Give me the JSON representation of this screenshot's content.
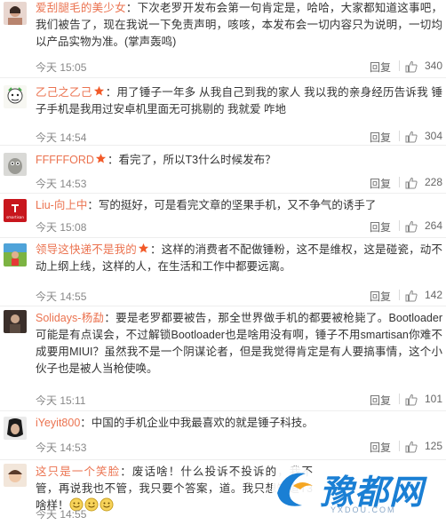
{
  "comments": [
    {
      "user": "爱刮腿毛的美少女",
      "verified": false,
      "text": "下次老罗开发布会第一句肯定是，哈哈，大家都知道这事吧，我们被告了，现在我说一下免责声明，咳咳，本发布会一切内容只为说明，一切均以产品实物为准。(掌声轰鸣)",
      "time": "今天 15:05",
      "reply": "回复",
      "likes": "340"
    },
    {
      "user": "乙己之乙己",
      "verified": true,
      "text": "用了锤子一年多 从我自己到我的家人 我以我的亲身经历告诉我  锤子手机是我用过安卓机里面无可挑剔的  我就爱 咋地",
      "time": "今天 14:54",
      "reply": "回复",
      "likes": "304"
    },
    {
      "user": "FFFFFORD",
      "verified": true,
      "text": "看完了，所以T3什么时候发布？",
      "time": "今天 14:53",
      "reply": "回复",
      "likes": "228"
    },
    {
      "user": "Liu-向上中",
      "verified": false,
      "text": "写的挺好，可是看完文章的坚果手机，又不争气的诱手了",
      "time": "今天 15:08",
      "reply": "回复",
      "likes": "264",
      "avatar_caption": "smartisan"
    },
    {
      "user": "领导这快递不是我的",
      "verified": true,
      "text": "这样的消费者不配做锤粉，这不是维权，这是碰瓷，动不动上纲上线，这样的人，在生活和工作中都要远离。",
      "time": "今天 14:55",
      "reply": "回复",
      "likes": "142"
    },
    {
      "user": "Solidays-杨勐",
      "verified": false,
      "text": "要是老罗都要被告，那全世界做手机的都要被枪毙了。Bootloader可能是有点误会，不过解锁Bootloader也是啥用没有啊，锤子不用smartisan你难不成要用MIUI？虽然我不是一个阴谋论者，但是我觉得肯定是有人要搞事情，这个小伙子也是被人当枪使唤。",
      "time": "今天 15:11",
      "reply": "回复",
      "likes": "101"
    },
    {
      "user": "iYeyit800",
      "verified": false,
      "text": "中国的手机企业中我最喜欢的就是锤子科技。",
      "time": "今天 14:53",
      "reply": "回复",
      "likes": "125"
    },
    {
      "user": "这只是一个笑脸",
      "verified": false,
      "text": "废话啥！什么投诉不投诉的，我不管，再说我也不管，我只要个答案，道。我只想知道T3啥样！",
      "time": "今天 14:55",
      "reply": "回复",
      "likes": ""
    }
  ],
  "watermark": {
    "text": "豫都网",
    "sub": "YXDOU.COM"
  },
  "colors": {
    "username": "#eb7350",
    "text": "#333333",
    "meta": "#888888",
    "star": "#f25a29",
    "watermark": "#1a7fd4"
  }
}
